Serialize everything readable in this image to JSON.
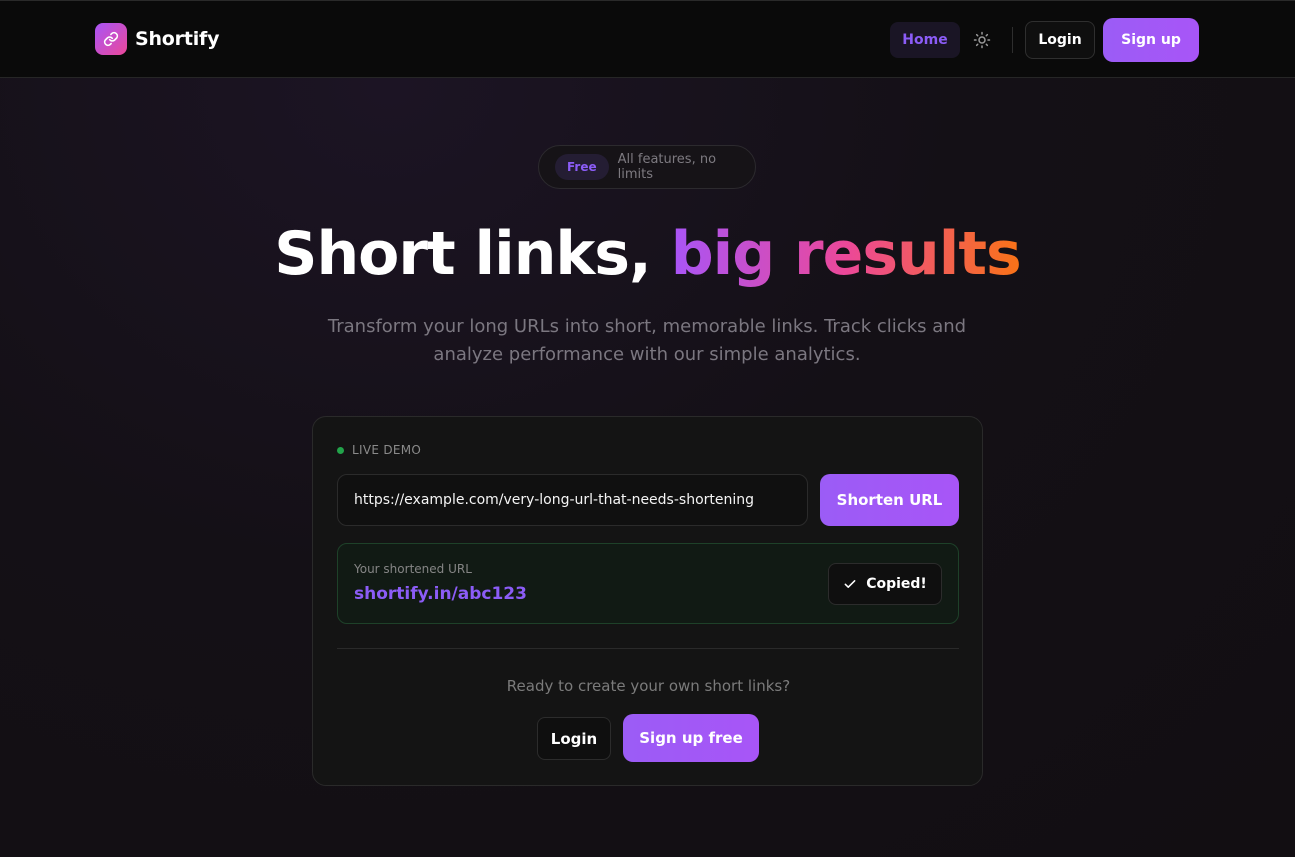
{
  "brand": {
    "name": "Shortify",
    "logo_icon": "link-icon"
  },
  "nav": {
    "home_label": "Home",
    "theme_icon": "sun-icon",
    "login_label": "Login",
    "signup_label": "Sign up"
  },
  "hero": {
    "badge": "Free",
    "badge_text": "All features, no limits",
    "title_plain": "Short links, ",
    "title_accent": "big results",
    "subtitle": "Transform your long URLs into short, memorable links. Track clicks and analyze performance with our simple analytics."
  },
  "demo": {
    "live_label": "LIVE DEMO",
    "input_value": "https://example.com/very-long-url-that-needs-shortening",
    "shorten_label": "Shorten URL",
    "result_label": "Your shortened URL",
    "result_url": "shortify.in/abc123",
    "copied_label": "Copied!",
    "cta_text": "Ready to create your own short links?",
    "cta_login_label": "Login",
    "cta_signup_label": "Sign up free"
  },
  "colors": {
    "accent": "#a855f7",
    "accent_pink": "#ec4899",
    "accent_orange": "#f97316",
    "live_green": "#22a34a",
    "background": "#141016"
  }
}
